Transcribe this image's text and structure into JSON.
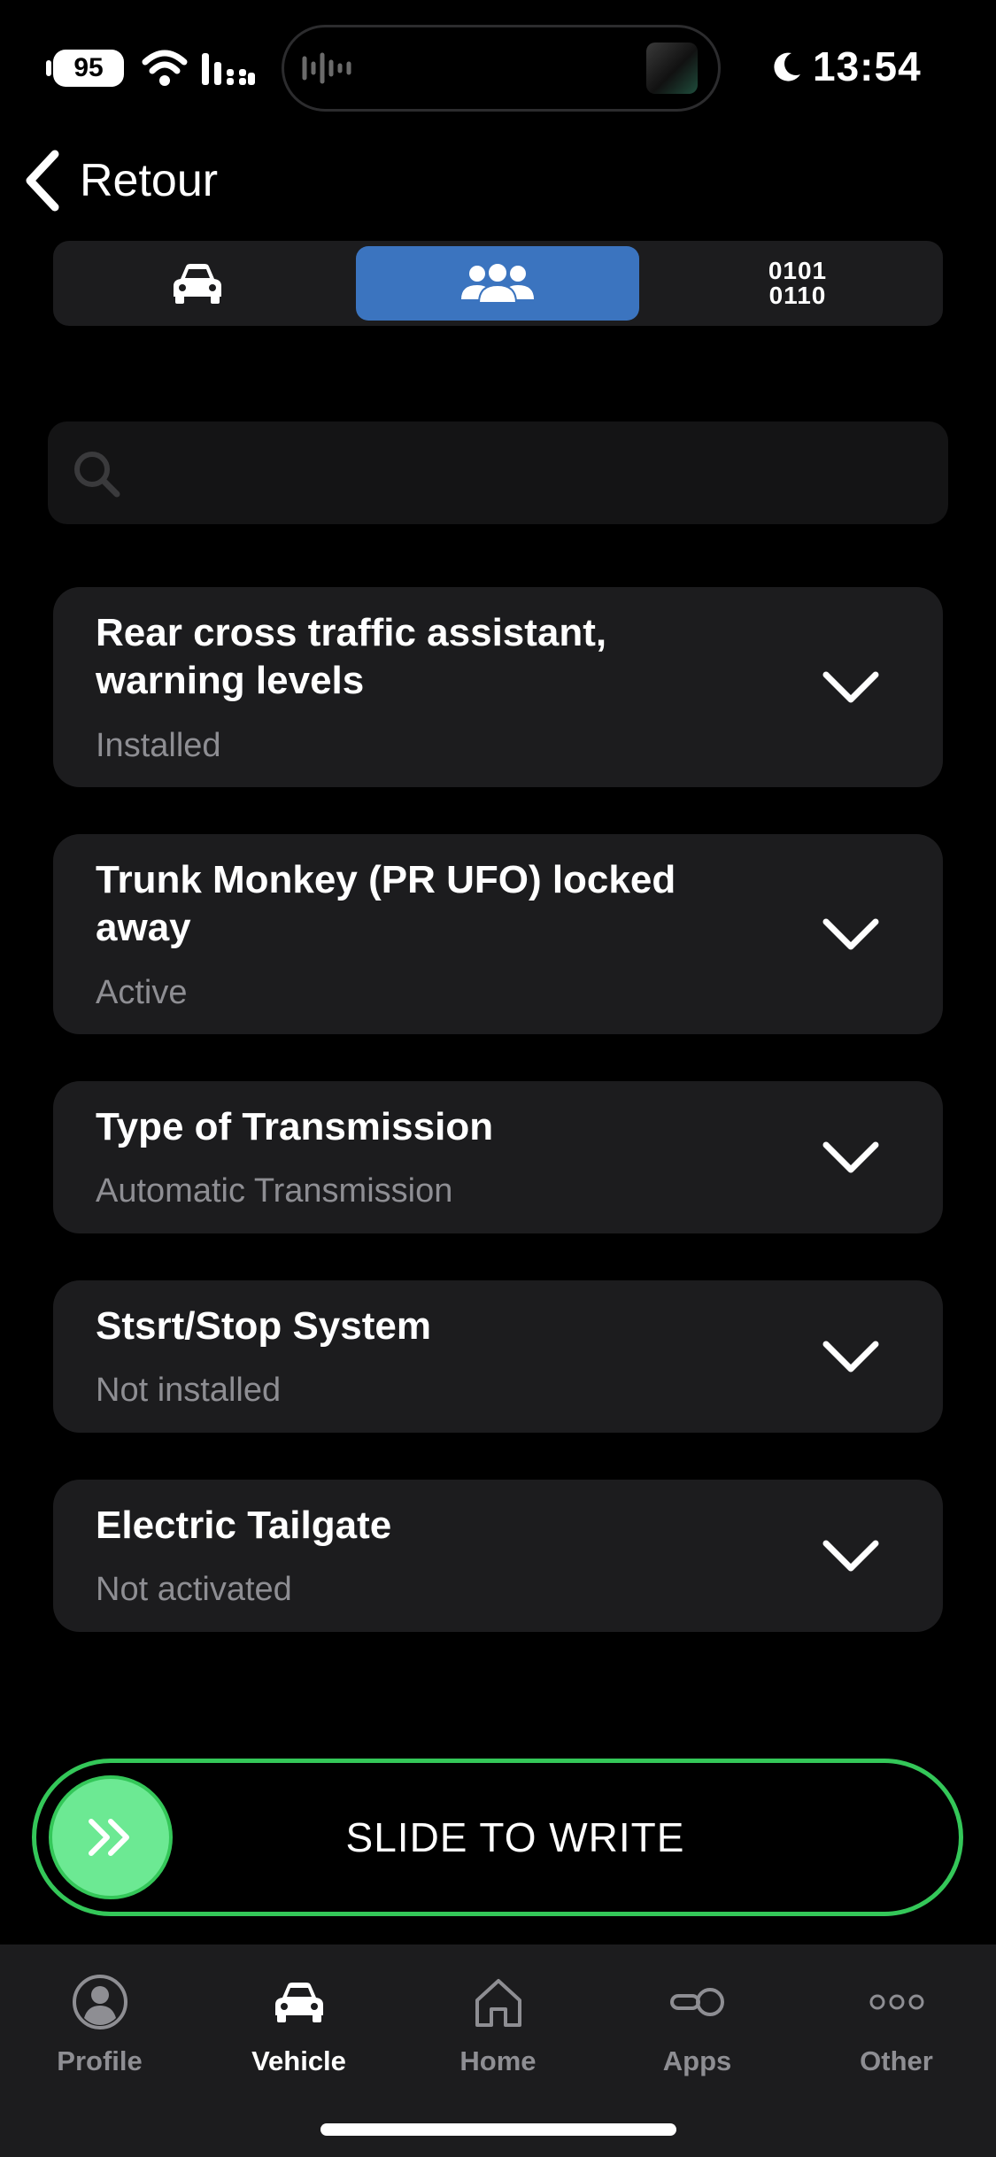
{
  "status_bar": {
    "battery": "95",
    "time": "13:54"
  },
  "nav": {
    "back_label": "Retour"
  },
  "segments": [
    {
      "icon": "car-icon",
      "active": false
    },
    {
      "icon": "group-icon",
      "active": true
    },
    {
      "icon": "binary-icon",
      "text_line1": "0101",
      "text_line2": "0110",
      "active": false
    }
  ],
  "search": {
    "placeholder": "",
    "value": ""
  },
  "items": [
    {
      "title": "Rear cross traffic assistant, warning levels",
      "status": "Installed"
    },
    {
      "title": "Trunk Monkey (PR UFO) locked away",
      "status": "Active"
    },
    {
      "title": "Type of Transmission",
      "status": "Automatic Transmission"
    },
    {
      "title": "Stsrt/Stop System",
      "status": "Not installed"
    },
    {
      "title": "Electric Tailgate",
      "status": "Not activated"
    }
  ],
  "slide": {
    "label": "SLIDE TO WRITE"
  },
  "tabs": [
    {
      "label": "Profile",
      "icon": "person-icon",
      "active": false
    },
    {
      "label": "Vehicle",
      "icon": "car-icon",
      "active": true
    },
    {
      "label": "Home",
      "icon": "home-icon",
      "active": false
    },
    {
      "label": "Apps",
      "icon": "toggle-icon",
      "active": false
    },
    {
      "label": "Other",
      "icon": "ellipsis-icon",
      "active": false
    }
  ],
  "colors": {
    "accent": "#3b74bf",
    "slide_green": "#34c759",
    "knob_green": "#6ce993",
    "card_bg": "#1c1c1e",
    "muted": "#8e8e93"
  }
}
